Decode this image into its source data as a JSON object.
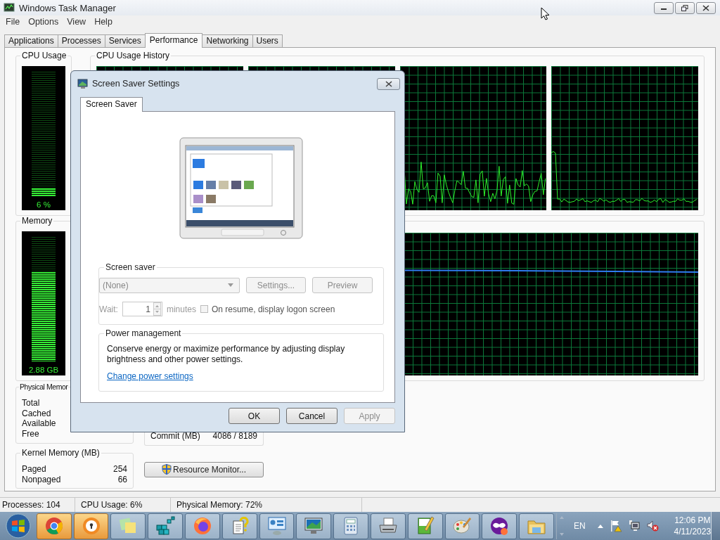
{
  "window": {
    "title": "Windows Task Manager"
  },
  "menu": [
    "File",
    "Options",
    "View",
    "Help"
  ],
  "tabs": [
    {
      "label": "Applications",
      "selected": false
    },
    {
      "label": "Processes",
      "selected": false
    },
    {
      "label": "Services",
      "selected": false
    },
    {
      "label": "Performance",
      "selected": true
    },
    {
      "label": "Networking",
      "selected": false
    },
    {
      "label": "Users",
      "selected": false
    }
  ],
  "cpu_usage": {
    "title": "CPU Usage",
    "level": 0.06,
    "reading": "6 %"
  },
  "cpu_history": {
    "title": "CPU Usage History"
  },
  "memory": {
    "title": "Memory",
    "level": 0.72,
    "reading": "2.88 GB"
  },
  "physical_memory": {
    "title": "Physical Memor",
    "rows": [
      {
        "label": "Total"
      },
      {
        "label": "Cached"
      },
      {
        "label": "Available"
      },
      {
        "label": "Free"
      }
    ]
  },
  "kernel_memory": {
    "title": "Kernel Memory (MB)",
    "rows": [
      {
        "label": "Paged",
        "value": "254"
      },
      {
        "label": "Nonpaged",
        "value": "66"
      }
    ]
  },
  "system": {
    "rows": [
      {
        "label": "Commit (MB)",
        "value": "4086 / 8189"
      }
    ]
  },
  "resource_monitor_button": "Resource Monitor...",
  "status_bar": [
    "Processes: 104",
    "CPU Usage: 6%",
    "Physical Memory: 72%"
  ],
  "dialog": {
    "title": "Screen Saver Settings",
    "tabs": [
      {
        "label": "Screen Saver",
        "selected": true
      }
    ],
    "screen_saver": {
      "title": "Screen saver",
      "select": {
        "value": "(None)",
        "disabled": true
      },
      "settings_button": {
        "label": "Settings...",
        "disabled": true
      },
      "preview_button": {
        "label": "Preview",
        "disabled": true
      },
      "wait_label": "Wait:",
      "wait": {
        "value": "1",
        "disabled": true
      },
      "minutes_label": "minutes",
      "logon_checkbox": {
        "label": "On resume, display logon screen",
        "checked": false,
        "disabled": true
      }
    },
    "power": {
      "title": "Power management",
      "text": "Conserve energy or maximize performance by adjusting display brightness and other power settings.",
      "link": "Change power settings"
    },
    "buttons": [
      {
        "label": "OK",
        "disabled": false
      },
      {
        "label": "Cancel",
        "disabled": false
      },
      {
        "label": "Apply",
        "disabled": true
      }
    ]
  },
  "taskbar": {
    "apps": [
      {
        "kind": "chrome",
        "active": true
      },
      {
        "kind": "vault",
        "active": true
      },
      {
        "kind": "notes",
        "active": false
      },
      {
        "kind": "registry",
        "active": false
      },
      {
        "kind": "firefox",
        "active": false
      },
      {
        "kind": "help",
        "active": false
      },
      {
        "kind": "control-panel",
        "active": false
      },
      {
        "kind": "display",
        "active": false
      },
      {
        "kind": "calculator",
        "active": false
      },
      {
        "kind": "fax",
        "active": false
      },
      {
        "kind": "notepad",
        "active": false
      },
      {
        "kind": "paint",
        "active": false
      },
      {
        "kind": "mask",
        "active": false
      },
      {
        "kind": "folder",
        "active": false
      }
    ],
    "language": "EN",
    "time": "12:06 PM",
    "date": "4/11/2023"
  }
}
